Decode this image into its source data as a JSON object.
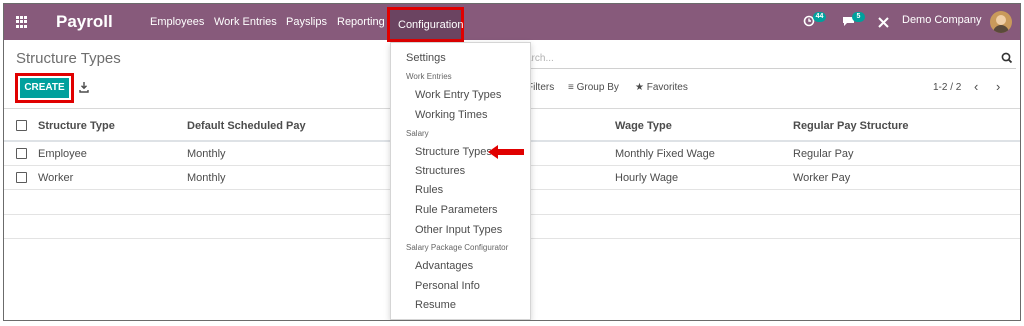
{
  "navbar": {
    "app_title": "Payroll",
    "menu": [
      "Employees",
      "Work Entries",
      "Payslips",
      "Reporting"
    ],
    "active_menu": "Configuration",
    "activity_badge": "44",
    "message_badge": "5",
    "company": "Demo Company",
    "icons": [
      "apps-grid-icon",
      "clock-activity-icon",
      "chat-icon",
      "tools-icon",
      "user-avatar"
    ]
  },
  "control_panel": {
    "title": "Structure Types",
    "search_placeholder": "arch...",
    "create_label": "CREATE",
    "filters_label": "Filters",
    "groupby_label": "Group By",
    "favorites_label": "Favorites",
    "pager": "1-2 / 2"
  },
  "table": {
    "columns": [
      "Structure Type",
      "Default Scheduled Pay",
      "Wage Type",
      "Regular Pay Structure"
    ],
    "rows": [
      {
        "type": "Employee",
        "pay": "Monthly",
        "wage": "Monthly Fixed Wage",
        "structure": "Regular Pay"
      },
      {
        "type": "Worker",
        "pay": "Monthly",
        "wage": "Hourly Wage",
        "structure": "Worker Pay"
      }
    ]
  },
  "dropdown": {
    "settings": "Settings",
    "work_entries_header": "Work Entries",
    "work_entry_types": "Work Entry Types",
    "working_times": "Working Times",
    "salary_header": "Salary",
    "structure_types": "Structure Types",
    "structures": "Structures",
    "rules": "Rules",
    "rule_parameters": "Rule Parameters",
    "other_input_types": "Other Input Types",
    "salary_package_header": "Salary Package Configurator",
    "advantages": "Advantages",
    "personal_info": "Personal Info",
    "resume": "Resume"
  },
  "colors": {
    "navbar": "#875a7b",
    "primary_button": "#00a09d",
    "highlight": "#e00000"
  }
}
